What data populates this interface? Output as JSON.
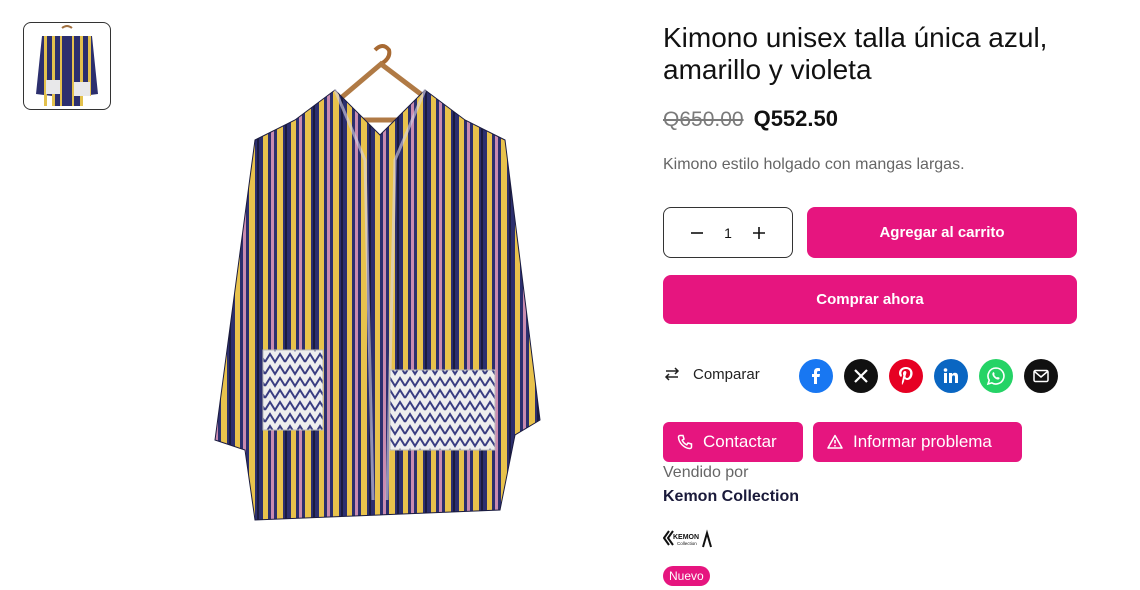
{
  "product": {
    "title": "Kimono unisex talla única azul, amarillo y violeta",
    "old_price": "Q650.00",
    "price": "Q552.50",
    "description": "Kimono estilo holgado con mangas largas.",
    "image_icon": "kimono-image"
  },
  "quantity": {
    "value": "1",
    "decrement_icon": "minus-icon",
    "increment_icon": "plus-icon"
  },
  "actions": {
    "add_to_cart": "Agregar al carrito",
    "buy_now": "Comprar ahora",
    "compare": "Comparar",
    "contact": "Contactar",
    "report": "Informar problema"
  },
  "share": [
    {
      "name": "facebook-icon",
      "color": "#1877f2"
    },
    {
      "name": "x-icon",
      "color": "#111111"
    },
    {
      "name": "pinterest-icon",
      "color": "#e60023"
    },
    {
      "name": "linkedin-icon",
      "color": "#0a66c2"
    },
    {
      "name": "whatsapp-icon",
      "color": "#25d366"
    },
    {
      "name": "email-icon",
      "color": "#111111"
    }
  ],
  "seller": {
    "label": "Vendido por",
    "name": "Kemon Collection",
    "logo_text": "KEMON",
    "logo_subtext": "Collection"
  },
  "badge": "Nuevo",
  "colors": {
    "accent": "#e6157f"
  }
}
